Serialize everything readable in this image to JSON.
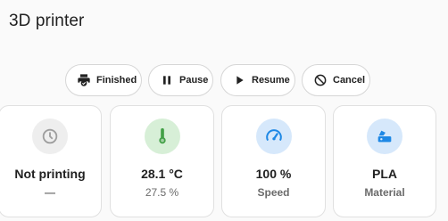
{
  "title": "3D printer",
  "buttons": [
    {
      "label": "Finished",
      "icon": "printer-check-icon"
    },
    {
      "label": "Pause",
      "icon": "pause-icon"
    },
    {
      "label": "Resume",
      "icon": "play-icon"
    },
    {
      "label": "Cancel",
      "icon": "cancel-icon"
    }
  ],
  "cards": [
    {
      "value": "Not printing",
      "sub": "—",
      "icon": "clock-outline-icon",
      "icon_color": "#9e9e9e",
      "icon_bg": "#eeeeee"
    },
    {
      "value": "28.1 °C",
      "sub": "27.5 %",
      "icon": "thermometer-icon",
      "icon_color": "#43a047",
      "icon_bg": "#d7efd7"
    },
    {
      "value": "100 %",
      "sub": "Speed",
      "icon": "speedometer-icon",
      "icon_color": "#1e88e5",
      "icon_bg": "#d6e8fb"
    },
    {
      "value": "PLA",
      "sub": "Material",
      "icon": "filament-icon",
      "icon_color": "#1e88e5",
      "icon_bg": "#d6e8fb"
    }
  ]
}
